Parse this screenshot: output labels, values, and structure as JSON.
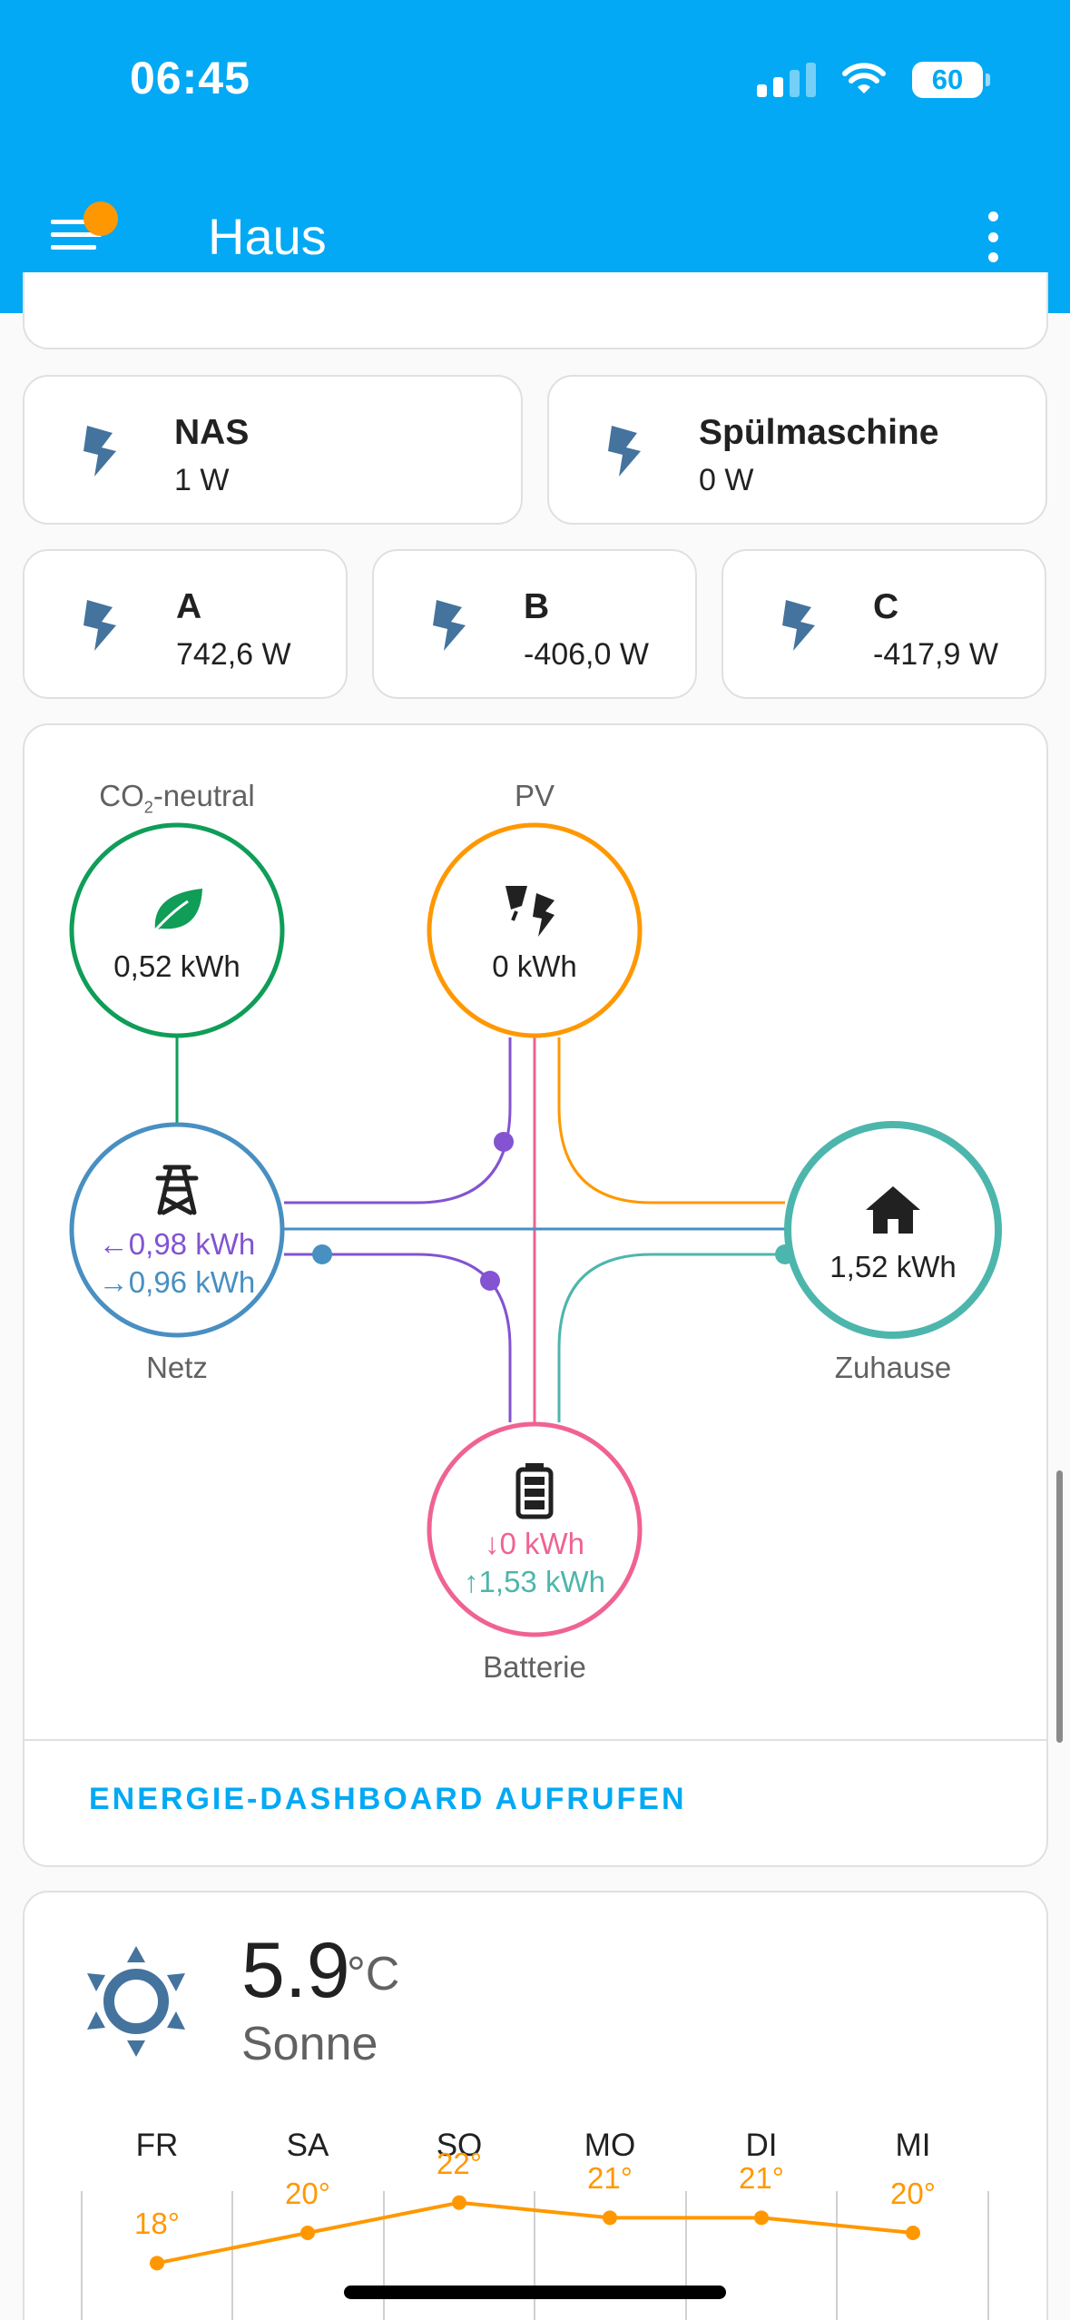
{
  "status": {
    "time": "06:45",
    "battery": "60"
  },
  "header": {
    "title": "Haus"
  },
  "tiles_row1": [
    {
      "name": "NAS",
      "value": "1 W"
    },
    {
      "name": "Spülmaschine",
      "value": "0 W"
    }
  ],
  "tiles_row2": [
    {
      "name": "A",
      "value": "742,6 W"
    },
    {
      "name": "B",
      "value": "-406,0 W"
    },
    {
      "name": "C",
      "value": "-417,9 W"
    }
  ],
  "energy": {
    "co2_label": "CO",
    "co2_sub": "2",
    "co2_suffix": "-neutral",
    "co2_value": "0,52 kWh",
    "pv_label": "PV",
    "pv_value": "0 kWh",
    "grid_label": "Netz",
    "grid_in": "←0,98 kWh",
    "grid_out": "→0,96 kWh",
    "home_label": "Zuhause",
    "home_value": "1,52 kWh",
    "battery_label": "Batterie",
    "battery_in": "↓0 kWh",
    "battery_out": "↑1,53 kWh",
    "dashboard_link": "ENERGIE-DASHBOARD AUFRUFEN",
    "colors": {
      "co2": "#0f9d58",
      "pv": "#ff9800",
      "grid": "#488fc2",
      "home": "#4db6ac",
      "battery": "#f06292",
      "grid_in": "#8353d1"
    }
  },
  "weather": {
    "temp": "5.9",
    "unit": "°C",
    "condition": "Sonne",
    "days": [
      "FR",
      "SA",
      "SO",
      "MO",
      "DI",
      "MI"
    ],
    "temps": [
      "18°",
      "20°",
      "22°",
      "21°",
      "21°",
      "20°"
    ],
    "temp_values": [
      18,
      20,
      22,
      21,
      21,
      20
    ]
  }
}
